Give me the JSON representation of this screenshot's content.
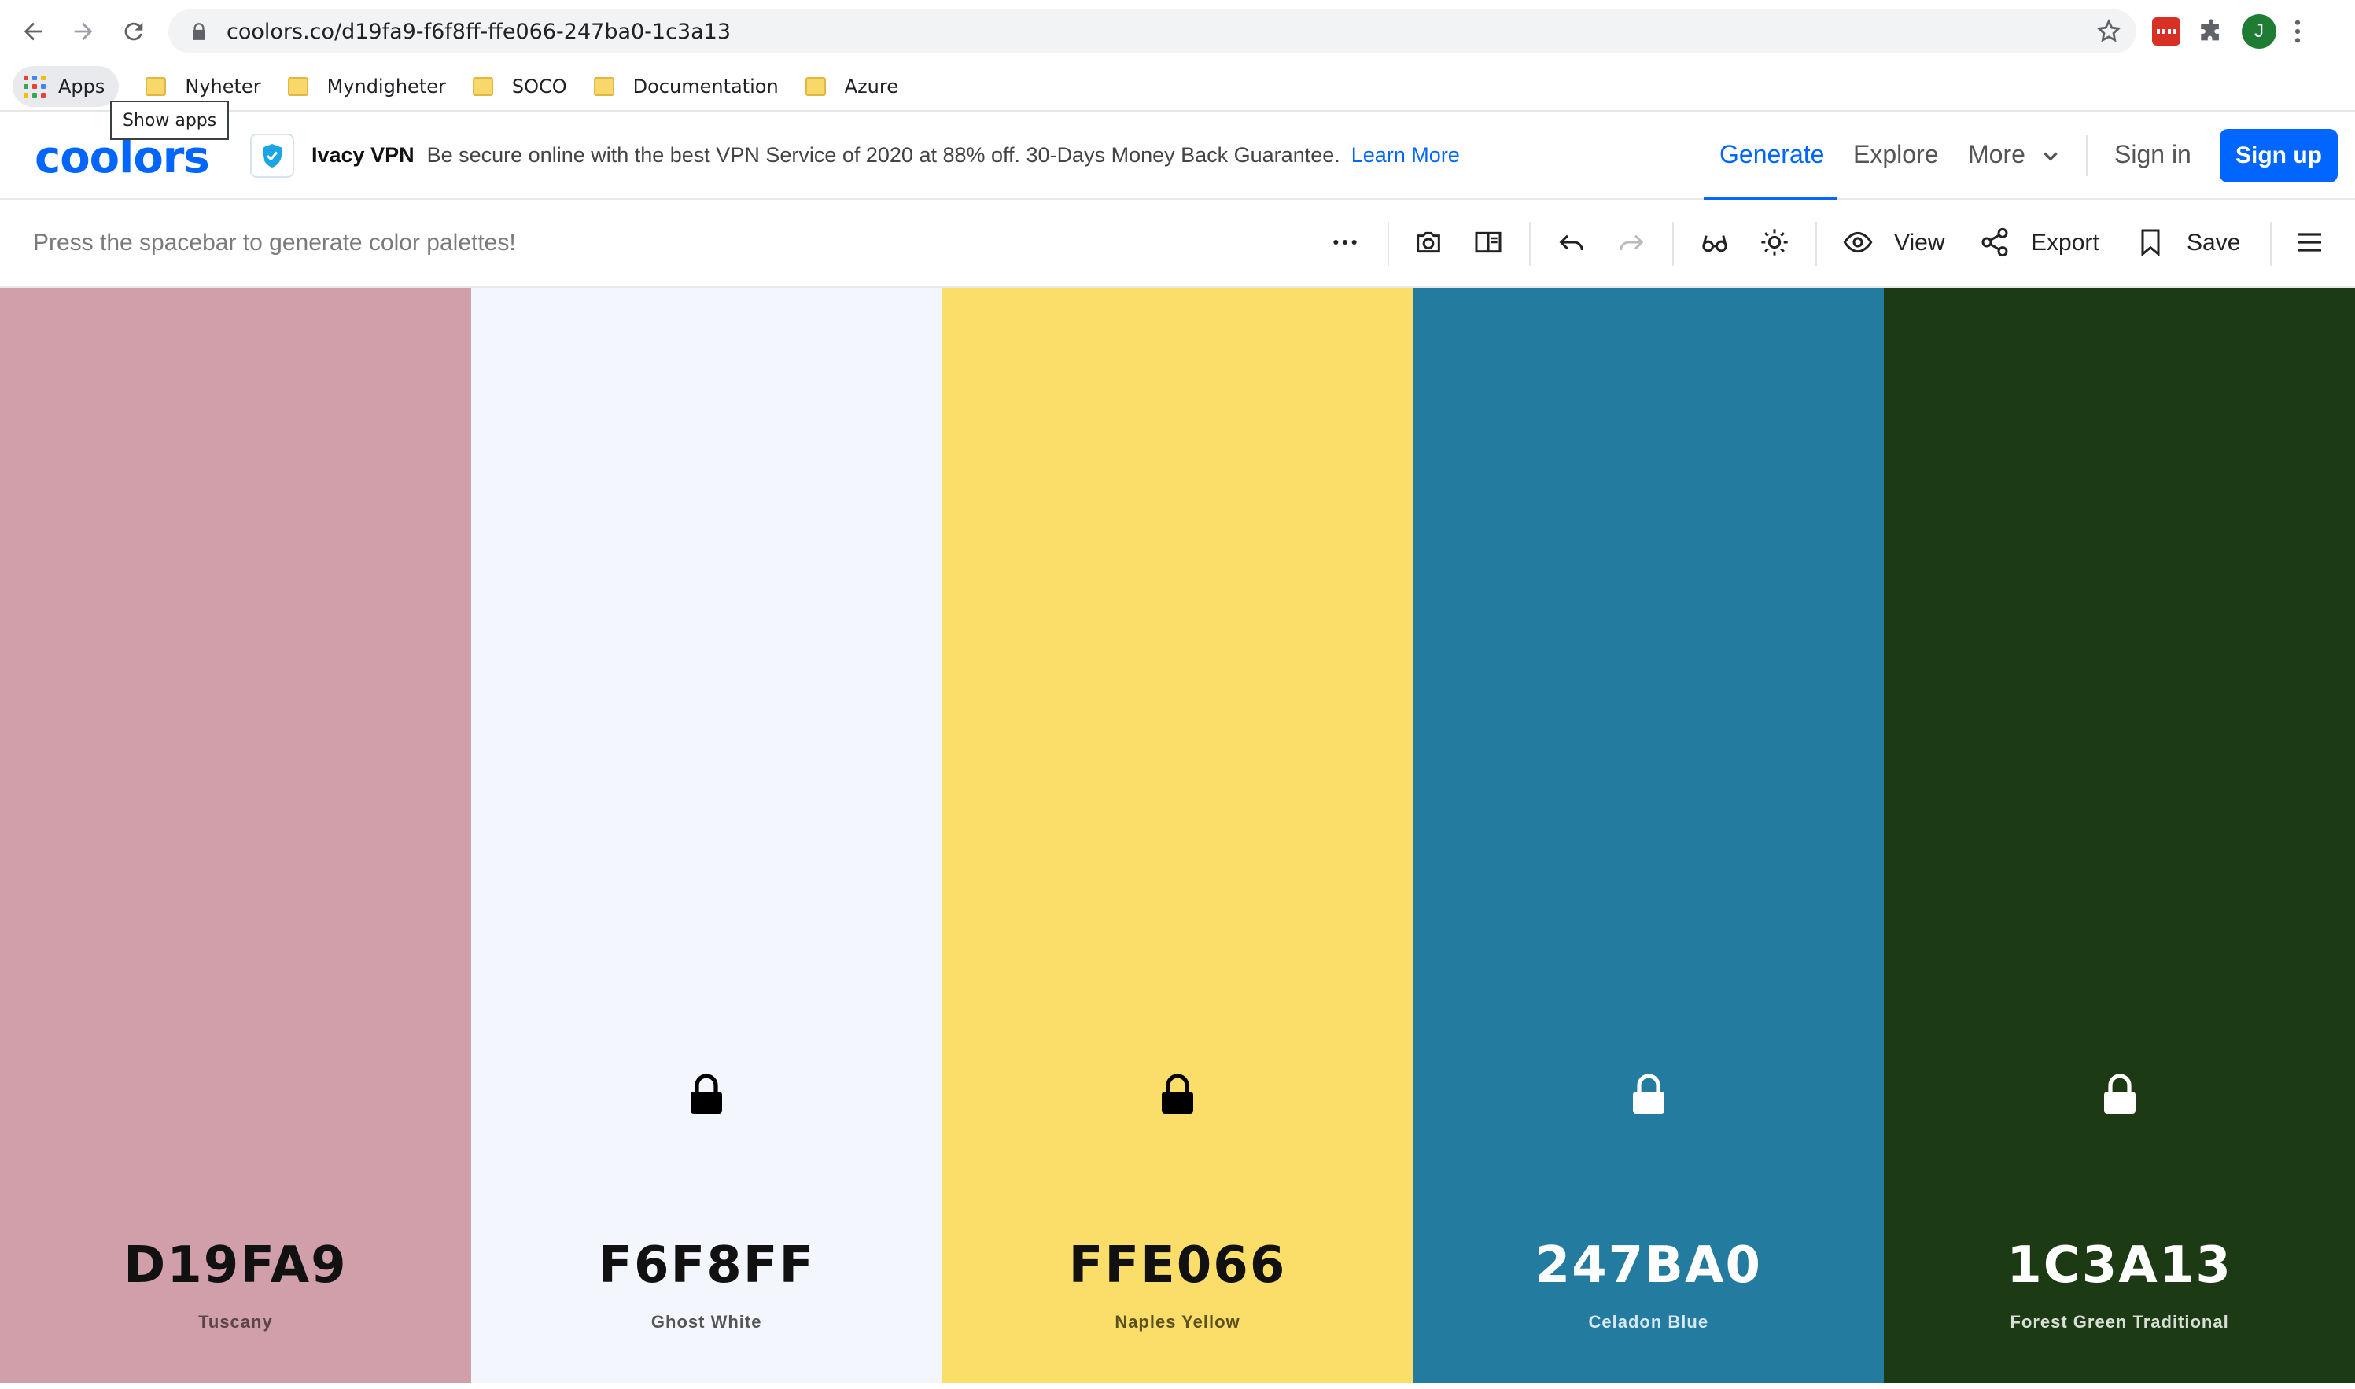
{
  "browser": {
    "url": "coolors.co/d19fa9-f6f8ff-ffe066-247ba0-1c3a13",
    "profile_initial": "J",
    "bookmarks": {
      "apps_label": "Apps",
      "items": [
        "Nyheter",
        "Myndigheter",
        "SOCO",
        "Documentation",
        "Azure"
      ]
    },
    "tooltip": "Show apps"
  },
  "header": {
    "logo": "coolors",
    "ad": {
      "brand": "Ivacy VPN",
      "text": "Be secure online with the best VPN Service of 2020 at 88% off. 30-Days Money Back Guarantee.",
      "link": "Learn More"
    },
    "nav": {
      "generate": "Generate",
      "explore": "Explore",
      "more": "More",
      "signin": "Sign in",
      "signup": "Sign up"
    }
  },
  "toolbar": {
    "hint": "Press the spacebar to generate color palettes!",
    "view": "View",
    "export": "Export",
    "save": "Save"
  },
  "palette": [
    {
      "hex": "D19FA9",
      "name": "Tuscany",
      "color": "#d19fa9",
      "text_color": "#111111",
      "name_color": "#5a4448",
      "locked": false,
      "lock_color": "#000000"
    },
    {
      "hex": "F6F8FF",
      "name": "Ghost White",
      "color": "#f4f6fd",
      "text_color": "#111111",
      "name_color": "#555555",
      "locked": true,
      "lock_color": "#000000"
    },
    {
      "hex": "FFE066",
      "name": "Naples Yellow",
      "color": "#fbdd69",
      "text_color": "#111111",
      "name_color": "#5b5120",
      "locked": true,
      "lock_color": "#000000"
    },
    {
      "hex": "247BA0",
      "name": "Celadon Blue",
      "color": "#247ba0",
      "text_color": "#ffffff",
      "name_color": "#d6e8f1",
      "locked": true,
      "lock_color": "#ffffff"
    },
    {
      "hex": "1C3A13",
      "name": "Forest Green Traditional",
      "color": "#1c3a13",
      "text_color": "#ffffff",
      "name_color": "#d8e0d5",
      "locked": true,
      "lock_color": "#ffffff"
    }
  ]
}
